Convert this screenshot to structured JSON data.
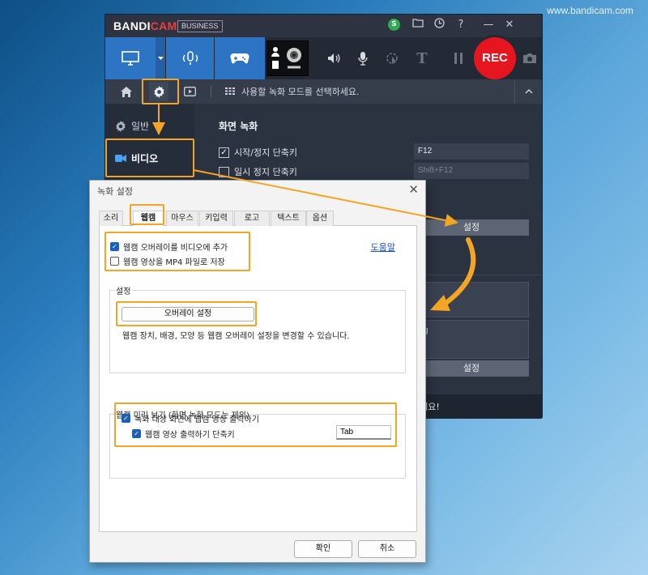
{
  "watermark": "www.bandicam.com",
  "bandicam": {
    "logo_a": "BANDI",
    "logo_b": "CAM",
    "edition": "BUSINESS",
    "badge": "S",
    "rec_label": "REC",
    "nav_text": "사용할 녹화 모드를 선택하세요.",
    "sidebar": [
      {
        "label": "일반",
        "icon": "gear-icon"
      },
      {
        "label": "비디오",
        "icon": "video-camera-icon"
      }
    ],
    "section_title": "화면 녹화",
    "rows": [
      {
        "label": "시작/정지 단축키",
        "hotkey": "F12"
      },
      {
        "label": "일시 정지 단축키",
        "hotkey": "Shift+F12"
      }
    ],
    "settings_btn_1": "설정",
    "settings_btn_2": "설정",
    "partial_text_1": "ng",
    "partial_status": "요세요!"
  },
  "dialog": {
    "title": "녹화 설정",
    "tabs": [
      "소리",
      "웹캠",
      "마우스",
      "키입력",
      "로고",
      "텍스트",
      "옵션"
    ],
    "selected_tab": "웹캠",
    "options": [
      {
        "label": "웹캠 오버레이를 비디오에 추가",
        "checked": true
      },
      {
        "label": "웹캠 영상을 MP4 파일로 저장",
        "checked": false
      }
    ],
    "help_link": "도움말",
    "settings_group": {
      "label": "설정",
      "button": "오버레이 설정",
      "description": "웹캠 장치, 배경, 모양 등 웹캠 오버레이 설정을 변경할 수 있습니다."
    },
    "preview_group": {
      "label": "웹캠 미리 보기 (화면 녹화 모드는 제외)",
      "option1": "녹화 대상 화면에 웹캠 영상 출력하기",
      "option2": "웹캠 영상 출력하기 단축키",
      "hotkey": "Tab"
    },
    "ok": "확인",
    "cancel": "취소"
  },
  "colors": {
    "highlight": "#f5a524",
    "rec": "#e5161f",
    "mode_active": "#2e74c4",
    "checkbox": "#1c5fb8"
  }
}
